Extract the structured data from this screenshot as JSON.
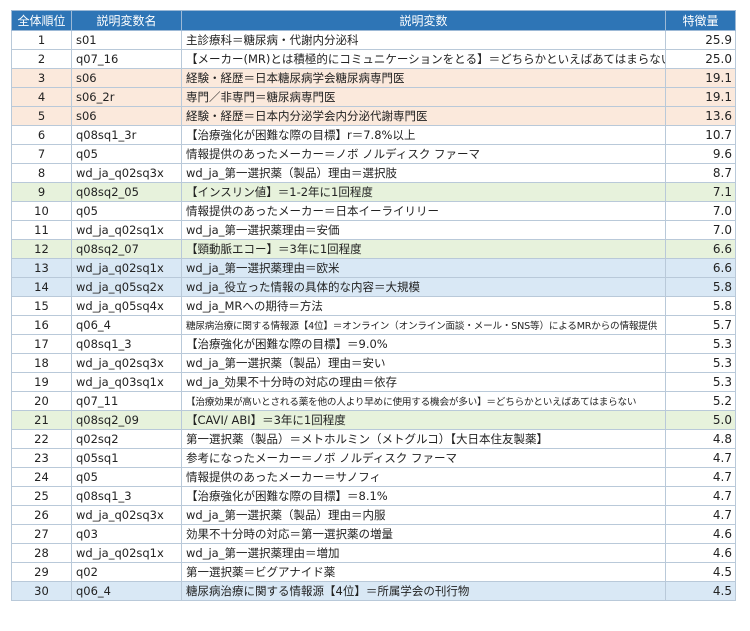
{
  "headers": [
    "全体順位",
    "説明変数名",
    "説明変数",
    "特徴量"
  ],
  "rows": [
    {
      "rank": "1",
      "name": "s01",
      "desc": "主診療科＝糖尿病・代謝内分泌科",
      "value": "25.9",
      "highlight": ""
    },
    {
      "rank": "2",
      "name": "q07_16",
      "desc": "【メーカー(MR)とは積極的にコミュニケーションをとる】＝どちらかといえばあてはまらない",
      "value": "25.0",
      "highlight": "",
      "small": false
    },
    {
      "rank": "3",
      "name": "s06",
      "desc": "経験・経歴＝日本糖尿病学会糖尿病専門医",
      "value": "19.1",
      "highlight": "orange"
    },
    {
      "rank": "4",
      "name": "s06_2r",
      "desc": "専門／非専門＝糖尿病専門医",
      "value": "19.1",
      "highlight": "orange"
    },
    {
      "rank": "5",
      "name": "s06",
      "desc": "経験・経歴＝日本内分泌学会内分泌代謝専門医",
      "value": "13.6",
      "highlight": "orange"
    },
    {
      "rank": "6",
      "name": "q08sq1_3r",
      "desc": "【治療強化が困難な際の目標】r＝7.8%以上",
      "value": "10.7",
      "highlight": ""
    },
    {
      "rank": "7",
      "name": "q05",
      "desc": "情報提供のあったメーカー＝ノボ ノルディスク ファーマ",
      "value": "9.6",
      "highlight": ""
    },
    {
      "rank": "8",
      "name": "wd_ja_q02sq3x",
      "desc": "wd_ja_第一選択薬（製品）理由＝選択肢",
      "value": "8.7",
      "highlight": ""
    },
    {
      "rank": "9",
      "name": "q08sq2_05",
      "desc": "【インスリン値】＝1-2年に1回程度",
      "value": "7.1",
      "highlight": "green"
    },
    {
      "rank": "10",
      "name": "q05",
      "desc": "情報提供のあったメーカー＝日本イーライリリー",
      "value": "7.0",
      "highlight": ""
    },
    {
      "rank": "11",
      "name": "wd_ja_q02sq1x",
      "desc": "wd_ja_第一選択薬理由＝安価",
      "value": "7.0",
      "highlight": ""
    },
    {
      "rank": "12",
      "name": "q08sq2_07",
      "desc": "【頸動脈エコー】＝3年に1回程度",
      "value": "6.6",
      "highlight": "green"
    },
    {
      "rank": "13",
      "name": "wd_ja_q02sq1x",
      "desc": "wd_ja_第一選択薬理由＝欧米",
      "value": "6.6",
      "highlight": "blue"
    },
    {
      "rank": "14",
      "name": "wd_ja_q05sq2x",
      "desc": "wd_ja_役立った情報の具体的な内容＝大規模",
      "value": "5.8",
      "highlight": "blue"
    },
    {
      "rank": "15",
      "name": "wd_ja_q05sq4x",
      "desc": "wd_ja_MRへの期待＝方法",
      "value": "5.8",
      "highlight": ""
    },
    {
      "rank": "16",
      "name": "q06_4",
      "desc": "糖尿病治療に関する情報源【4位】＝オンライン（オンライン面談・メール・SNS等）によるMRからの情報提供",
      "value": "5.7",
      "highlight": "",
      "small": true
    },
    {
      "rank": "17",
      "name": "q08sq1_3",
      "desc": "【治療強化が困難な際の目標】＝9.0%",
      "value": "5.3",
      "highlight": ""
    },
    {
      "rank": "18",
      "name": "wd_ja_q02sq3x",
      "desc": "wd_ja_第一選択薬（製品）理由＝安い",
      "value": "5.3",
      "highlight": ""
    },
    {
      "rank": "19",
      "name": "wd_ja_q03sq1x",
      "desc": "wd_ja_効果不十分時の対応の理由＝依存",
      "value": "5.3",
      "highlight": ""
    },
    {
      "rank": "20",
      "name": "q07_11",
      "desc": "【治療効果が高いとされる薬を他の人より早めに使用する機会が多い】＝どちらかといえばあてはまらない",
      "value": "5.2",
      "highlight": "",
      "small": true
    },
    {
      "rank": "21",
      "name": "q08sq2_09",
      "desc": "【CAVI/ ABI】＝3年に1回程度",
      "value": "5.0",
      "highlight": "green"
    },
    {
      "rank": "22",
      "name": "q02sq2",
      "desc": "第一選択薬（製品）＝メトホルミン（メトグルコ）【大日本住友製薬】",
      "value": "4.8",
      "highlight": ""
    },
    {
      "rank": "23",
      "name": "q05sq1",
      "desc": "参考になったメーカー＝ノボ ノルディスク ファーマ",
      "value": "4.7",
      "highlight": ""
    },
    {
      "rank": "24",
      "name": "q05",
      "desc": "情報提供のあったメーカー＝サノフィ",
      "value": "4.7",
      "highlight": ""
    },
    {
      "rank": "25",
      "name": "q08sq1_3",
      "desc": "【治療強化が困難な際の目標】＝8.1%",
      "value": "4.7",
      "highlight": ""
    },
    {
      "rank": "26",
      "name": "wd_ja_q02sq3x",
      "desc": "wd_ja_第一選択薬（製品）理由＝内服",
      "value": "4.7",
      "highlight": ""
    },
    {
      "rank": "27",
      "name": "q03",
      "desc": "効果不十分時の対応＝第一選択薬の増量",
      "value": "4.6",
      "highlight": ""
    },
    {
      "rank": "28",
      "name": "wd_ja_q02sq1x",
      "desc": "wd_ja_第一選択薬理由＝増加",
      "value": "4.6",
      "highlight": ""
    },
    {
      "rank": "29",
      "name": "q02",
      "desc": "第一選択薬＝ビグアナイド薬",
      "value": "4.5",
      "highlight": ""
    },
    {
      "rank": "30",
      "name": "q06_4",
      "desc": "糖尿病治療に関する情報源【4位】＝所属学会の刊行物",
      "value": "4.5",
      "highlight": "blue"
    }
  ]
}
